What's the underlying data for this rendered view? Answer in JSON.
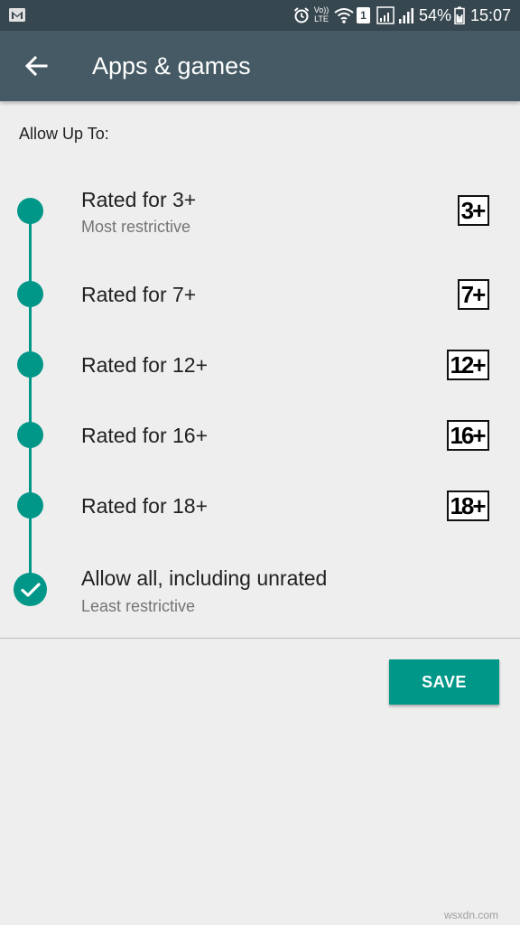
{
  "status_bar": {
    "battery": "54%",
    "time": "15:07",
    "volte": "Vo)) LTE",
    "sim_slot": "1",
    "icons": [
      "gmail-icon",
      "alarm-icon",
      "volte-icon",
      "wifi-icon",
      "sim-1-icon",
      "signal-icon",
      "signal-icon-2",
      "battery-charging-icon"
    ]
  },
  "app_bar": {
    "title": "Apps & games",
    "back_icon": "arrow-back-icon"
  },
  "section_label": "Allow Up To:",
  "options": [
    {
      "title": "Rated for 3+",
      "subtitle": "Most restrictive",
      "badge": "3+"
    },
    {
      "title": "Rated for 7+",
      "badge": "7+"
    },
    {
      "title": "Rated for 12+",
      "badge": "12+"
    },
    {
      "title": "Rated for 16+",
      "badge": "16+"
    },
    {
      "title": "Rated for 18+",
      "badge": "18+"
    },
    {
      "title": "Allow all, including unrated",
      "subtitle": "Least restrictive",
      "selected": true
    }
  ],
  "save_label": "SAVE",
  "watermark": "wsxdn.com",
  "colors": {
    "status_bar": "#37474f",
    "app_bar": "#455a64",
    "accent": "#009688",
    "background": "#eeeeee"
  }
}
